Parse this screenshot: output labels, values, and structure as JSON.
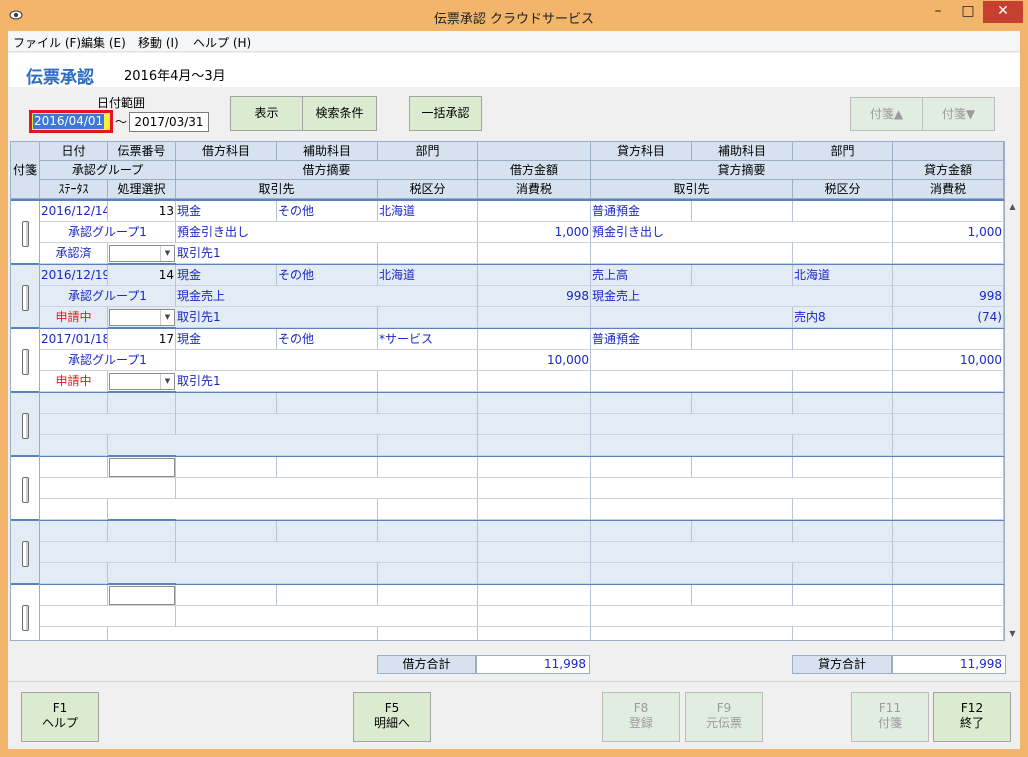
{
  "window": {
    "title": "伝票承認 クラウドサービス",
    "min": "–",
    "max": "□",
    "close": "✕"
  },
  "menu": [
    "ファイル (F)",
    "編集 (E)",
    "移動 (I)",
    "ヘルプ (H)"
  ],
  "page": {
    "title": "伝票承認",
    "period": "2016年4月～3月"
  },
  "filter": {
    "date_label": "日付範囲",
    "from": "2016/04/01",
    "tilde": "～",
    "to": "2017/03/31"
  },
  "buttons": {
    "show": "表示",
    "search": "検索条件",
    "bulk": "一括承認",
    "tag_up": "付箋▲",
    "tag_down": "付箋▼"
  },
  "headers": {
    "tag": "付箋",
    "date": "日付",
    "slip_no": "伝票番号",
    "approval_group": "承認グループ",
    "status": "ｽﾃｰﾀｽ",
    "process": "処理選択",
    "dr_account": "借方科目",
    "dr_sub": "補助科目",
    "dr_dept": "部門",
    "dr_summary": "借方摘要",
    "dr_amount": "借方金額",
    "partner": "取引先",
    "tax_class": "税区分",
    "tax": "消費税",
    "cr_account": "貸方科目",
    "cr_sub": "補助科目",
    "cr_dept": "部門",
    "cr_summary": "貸方摘要",
    "cr_amount": "貸方金額",
    "cr_partner": "取引先",
    "cr_tax_class": "税区分",
    "cr_tax": "消費税"
  },
  "rows": [
    {
      "date": "2016/12/14",
      "no": "13",
      "group": "承認グループ1",
      "status": "承認済",
      "status_color": "#1a26c8",
      "dr_account": "現金",
      "dr_sub": "その他",
      "dr_dept": "北海道",
      "dr_summary": "預金引き出し",
      "dr_amount": "1,000",
      "dr_partner": "取引先1",
      "cr_account": "普通預金",
      "cr_sub": "",
      "cr_dept": "",
      "cr_summary": "預金引き出し",
      "cr_amount": "1,000",
      "cr_tax_class": "",
      "cr_tax": ""
    },
    {
      "date": "2016/12/19",
      "no": "14",
      "group": "承認グループ1",
      "status": "申請中",
      "status_color": "#e0201e",
      "dr_account": "現金",
      "dr_sub": "その他",
      "dr_dept": "北海道",
      "dr_summary": "現金売上",
      "dr_amount": "998",
      "dr_partner": "取引先1",
      "cr_account": "売上高",
      "cr_sub": "",
      "cr_dept": "北海道",
      "cr_summary": "現金売上",
      "cr_amount": "998",
      "cr_tax_class": "売内8",
      "cr_tax": "(74)"
    },
    {
      "date": "2017/01/18",
      "no": "17",
      "group": "承認グループ1",
      "status": "申請中",
      "status_color": "#e0201e",
      "dr_account": "現金",
      "dr_sub": "その他",
      "dr_dept": "*サービス",
      "dr_summary": "",
      "dr_amount": "10,000",
      "dr_partner": "取引先1",
      "cr_account": "普通預金",
      "cr_sub": "",
      "cr_dept": "",
      "cr_summary": "",
      "cr_amount": "10,000",
      "cr_tax_class": "",
      "cr_tax": ""
    }
  ],
  "totals": {
    "dr_label": "借方合計",
    "dr_value": "11,998",
    "cr_label": "貸方合計",
    "cr_value": "11,998"
  },
  "fkeys": [
    {
      "key": "F1",
      "label": "ヘルプ",
      "enabled": true
    },
    {
      "key": "F5",
      "label": "明細へ",
      "enabled": true
    },
    {
      "key": "F8",
      "label": "登録",
      "enabled": false
    },
    {
      "key": "F9",
      "label": "元伝票",
      "enabled": false
    },
    {
      "key": "F11",
      "label": "付箋",
      "enabled": false
    },
    {
      "key": "F12",
      "label": "終了",
      "enabled": true
    }
  ]
}
